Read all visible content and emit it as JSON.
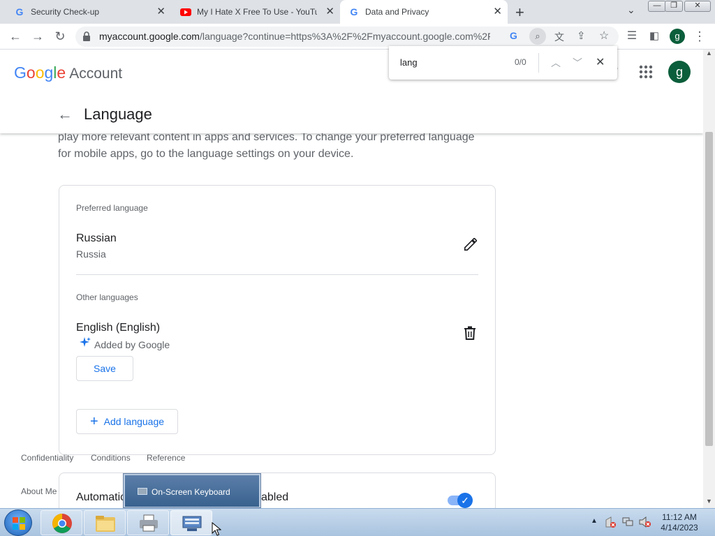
{
  "browser": {
    "tabs": [
      {
        "title": "Security Check-up",
        "favicon": "google-g-icon"
      },
      {
        "title": "My I Hate X Free To Use - YouTube",
        "favicon": "youtube-icon"
      },
      {
        "title": "Data and Privacy",
        "favicon": "google-g-icon"
      }
    ],
    "new_tab": "+",
    "address": {
      "host": "myaccount.google.com",
      "rest": "/language?continue=https%3A%2F%2Fmyaccount.google.com%2Fp..."
    },
    "profile_initial": "g",
    "find": {
      "query": "lang",
      "count": "0/0"
    }
  },
  "header": {
    "logo_google": "Google",
    "logo_account": "Account",
    "avatar_initial": "g",
    "page_title": "Language"
  },
  "intro_text": "play more relevant content in apps and services. To change your preferred language for mobile apps, go to the language settings on your device.",
  "preferred": {
    "label": "Preferred language",
    "language": "Russian",
    "region": "Russia"
  },
  "other": {
    "label": "Other languages",
    "language": "English (English)",
    "added_by": "Added by Google",
    "save_label": "Save",
    "add_label": "Add language"
  },
  "footer": {
    "links": [
      "Confidentiality",
      "Conditions",
      "Reference"
    ],
    "about": "About Me"
  },
  "auto_card": {
    "title_start": "Automatic",
    "title_end": "abled",
    "toggle_on": true
  },
  "osk": {
    "label": "On-Screen Keyboard"
  },
  "clock": {
    "time": "11:12 AM",
    "date": "4/14/2023"
  },
  "colors": {
    "accent": "#1a73e8",
    "avatar": "#0b5e3b"
  }
}
